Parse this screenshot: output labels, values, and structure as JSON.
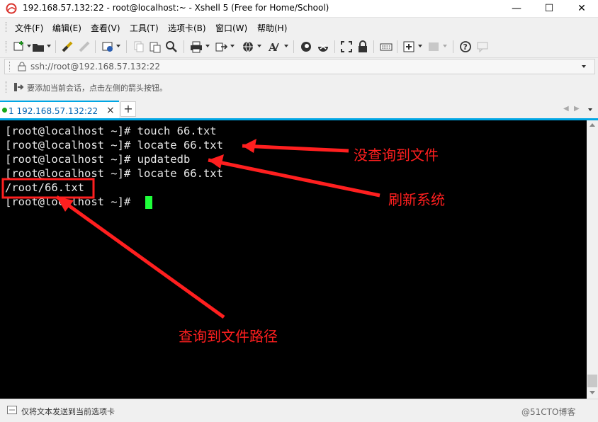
{
  "window": {
    "title": "192.168.57.132:22 - root@localhost:~ - Xshell 5 (Free for Home/School)",
    "minimize": "—",
    "maximize": "☐",
    "close": "✕"
  },
  "menu": [
    {
      "label": "文件(F)"
    },
    {
      "label": "编辑(E)"
    },
    {
      "label": "查看(V)"
    },
    {
      "label": "工具(T)"
    },
    {
      "label": "选项卡(B)"
    },
    {
      "label": "窗口(W)"
    },
    {
      "label": "帮助(H)"
    }
  ],
  "address": {
    "value": "ssh://root@192.168.57.132:22"
  },
  "hint": {
    "text": "要添加当前会话，点击左侧的箭头按钮。"
  },
  "tabs": [
    {
      "label": "1 192.168.57.132:22",
      "active": true
    }
  ],
  "tab_add": "+",
  "terminal": {
    "lines": [
      "[root@localhost ~]# touch 66.txt",
      "[root@localhost ~]# locate 66.txt",
      "[root@localhost ~]# updatedb",
      "[root@localhost ~]# locate 66.txt",
      "/root/66.txt",
      "[root@localhost ~]# "
    ],
    "cursor_color": "#1eff3a"
  },
  "annotations": {
    "no_file": "没查询到文件",
    "refresh": "刷新系统",
    "found_path": "查询到文件路径",
    "color": "#ff1f1f"
  },
  "status": {
    "text": "仅将文本发送到当前选项卡",
    "watermark": "@51CTO博客"
  },
  "colors": {
    "accent": "#00a6e4",
    "terminal_bg": "#000000",
    "terminal_fg": "#e8e8e8"
  }
}
